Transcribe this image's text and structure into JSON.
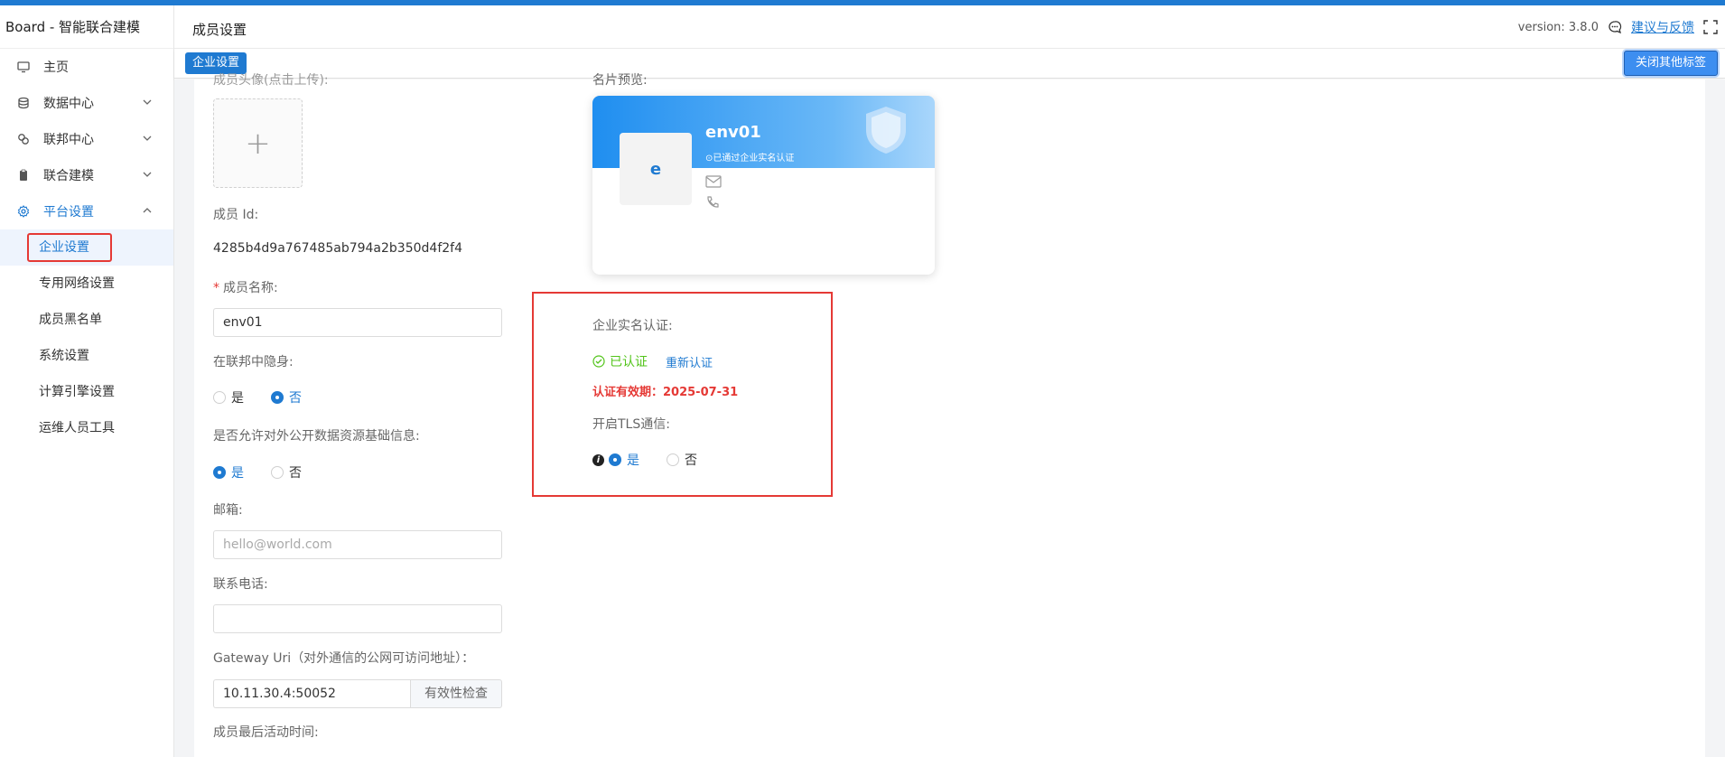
{
  "app": {
    "brand": "Board - 智能联合建模"
  },
  "sidebar": {
    "items": [
      {
        "label": "主页",
        "icon": "monitor-icon"
      },
      {
        "label": "数据中心",
        "icon": "database-icon"
      },
      {
        "label": "联邦中心",
        "icon": "link-icon"
      },
      {
        "label": "联合建模",
        "icon": "clipboard-icon"
      },
      {
        "label": "平台设置",
        "icon": "gear-icon"
      }
    ],
    "sub_items": [
      {
        "label": "企业设置"
      },
      {
        "label": "专用网络设置"
      },
      {
        "label": "成员黑名单"
      },
      {
        "label": "系统设置"
      },
      {
        "label": "计算引擎设置"
      },
      {
        "label": "运维人员工具"
      }
    ]
  },
  "header": {
    "title": "成员设置",
    "version": "version: 3.8.0",
    "feedback": "建议与反馈"
  },
  "tabs": {
    "active": "企业设置",
    "close_others": "关闭其他标签"
  },
  "form": {
    "avatar_label": "成员头像(点击上传):",
    "member_id_label": "成员 Id:",
    "member_id": "4285b4d9a767485ab794a2b350d4f2f4",
    "name_label": "成员名称:",
    "name_value": "env01",
    "hidden_label": "在联邦中隐身:",
    "public_label": "是否允许对外公开数据资源基础信息:",
    "yes": "是",
    "no": "否",
    "email_label": "邮箱:",
    "email_placeholder": "hello@world.com",
    "phone_label": "联系电话:",
    "gateway_label": "Gateway Uri（对外通信的公网可访问地址）：",
    "gateway_value": "10.11.30.4:50052",
    "check_button": "有效性检查",
    "last_active_label": "成员最后活动时间:"
  },
  "card": {
    "preview_label": "名片预览:",
    "name": "env01",
    "avatar_letter": "e",
    "verified": "已通过企业实名认证"
  },
  "verification": {
    "label": "企业实名认证:",
    "status": "已认证",
    "reverify": "重新认证",
    "validity": "认证有效期：2025-07-31",
    "tls_label": "开启TLS通信:"
  },
  "colors": {
    "accent": "#1f7ad1",
    "success": "#52c41a",
    "danger": "#e53935"
  }
}
